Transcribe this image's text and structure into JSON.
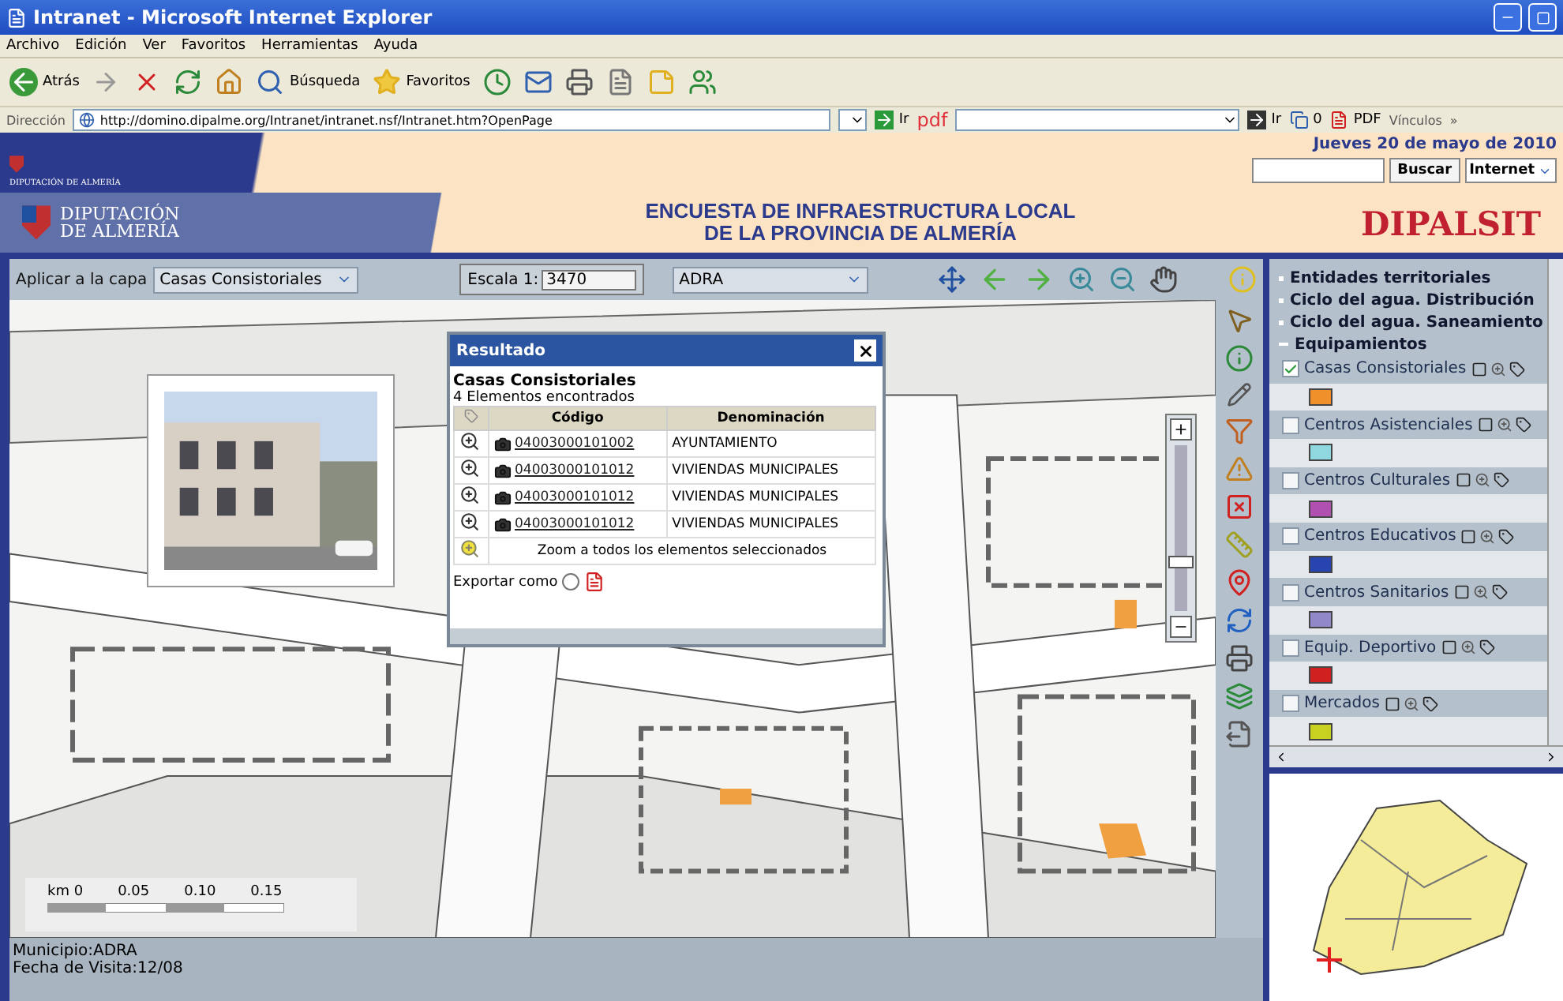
{
  "window": {
    "title": "Intranet - Microsoft Internet Explorer"
  },
  "menu": [
    "Archivo",
    "Edición",
    "Ver",
    "Favoritos",
    "Herramientas",
    "Ayuda"
  ],
  "toolbar": {
    "back": "Atrás",
    "search": "Búsqueda",
    "favorites": "Favoritos"
  },
  "address": {
    "label": "Dirección",
    "url": "http://domino.dipalme.org/Intranet/intranet.nsf/Intranet.htm?OpenPage",
    "go": "Ir",
    "pdf": "pdf",
    "go2": "Ir",
    "count": "0",
    "pdf_button": "PDF",
    "links": "Vínculos",
    "more": "»"
  },
  "site_header": {
    "logo_text": "DIPUTACIÓN DE ALMERÍA",
    "date": "Jueves 20 de mayo de 2010",
    "search_button": "Buscar",
    "scope": "Internet"
  },
  "banner": {
    "org": [
      "DIPUTACIÓN",
      "DE ALMERÍA"
    ],
    "title": [
      "ENCUESTA DE INFRAESTRUCTURA LOCAL",
      "DE LA PROVINCIA DE ALMERÍA"
    ],
    "brand": "DIPALSIT"
  },
  "map_toolbar": {
    "layer_label": "Aplicar a la capa",
    "layer": "Casas Consistoriales",
    "scale_label": "Escala 1:",
    "scale": "3470",
    "municipality": "ADRA"
  },
  "result": {
    "title": "Resultado",
    "layer": "Casas Consistoriales",
    "count": "4 Elementos encontrados",
    "columns": [
      "Código",
      "Denominación"
    ],
    "rows": [
      {
        "code": "04003000101002",
        "name": "AYUNTAMIENTO"
      },
      {
        "code": "04003000101012",
        "name": "VIVIENDAS MUNICIPALES"
      },
      {
        "code": "04003000101012",
        "name": "VIVIENDAS MUNICIPALES"
      },
      {
        "code": "04003000101012",
        "name": "VIVIENDAS MUNICIPALES"
      }
    ],
    "zoom_all": "Zoom a todos los elementos seleccionados",
    "export": "Exportar como",
    "export_checked": false
  },
  "zoom_slider": {
    "level": 0.3
  },
  "scale_bar": {
    "unit": "km",
    "ticks": [
      "0",
      "0.05",
      "0.10",
      "0.15"
    ]
  },
  "layers": [
    {
      "label": "Entidades territoriales",
      "expanded": false
    },
    {
      "label": "Ciclo del agua. Distribución",
      "expanded": false
    },
    {
      "label": "Ciclo del agua. Saneamiento",
      "expanded": false
    },
    {
      "label": "Equipamientos",
      "expanded": true,
      "children": [
        {
          "label": "Casas Consistoriales",
          "checked": true,
          "color": "#f0902a"
        },
        {
          "label": "Centros Asistenciales",
          "checked": false,
          "color": "#90d8e0"
        },
        {
          "label": "Centros Culturales",
          "checked": false,
          "color": "#b050b0"
        },
        {
          "label": "Centros Educativos",
          "checked": false,
          "color": "#2844b0"
        },
        {
          "label": "Centros Sanitarios",
          "checked": false,
          "color": "#9088c8"
        },
        {
          "label": "Equip. Deportivo",
          "checked": false,
          "color": "#d02020"
        },
        {
          "label": "Mercados",
          "checked": false,
          "color": "#c8d020"
        }
      ]
    }
  ],
  "status": [
    "Municipio:ADRA",
    "Fecha de Visita:12/08"
  ]
}
